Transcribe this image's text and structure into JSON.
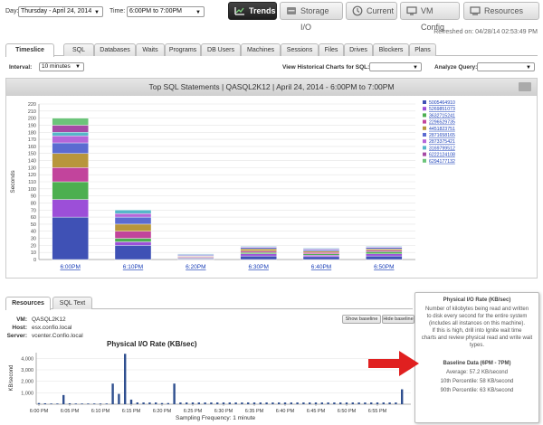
{
  "toolbar": {
    "day_label": "Day:",
    "day_value": "Thursday - April 24, 2014",
    "time_label": "Time:",
    "time_value": "6:00PM to 7:00PM",
    "nav": [
      {
        "label": "Trends",
        "icon": "trends-icon",
        "active": true
      },
      {
        "label": "Storage I/O",
        "icon": "storage-icon",
        "active": false
      },
      {
        "label": "Current",
        "icon": "clock-icon",
        "active": false
      },
      {
        "label": "VM Config",
        "icon": "monitor-icon",
        "active": false
      },
      {
        "label": "Resources",
        "icon": "resources-icon",
        "active": false
      }
    ]
  },
  "refreshed": "Refreshed on: 04/28/14 02:53:49 PM",
  "tabs": [
    "Timeslice",
    "SQL",
    "Databases",
    "Waits",
    "Programs",
    "DB Users",
    "Machines",
    "Sessions",
    "Files",
    "Drives",
    "Blockers",
    "Plans"
  ],
  "options": {
    "interval_label": "Interval:",
    "interval_value": "10 minutes",
    "historical_label": "View Historical Charts for SQL:",
    "analyze_label": "Analyze Query:"
  },
  "top_chart": {
    "title": "Top SQL Statements | QASQL2K12 | April 24, 2014 - 6:00PM to 7:00PM"
  },
  "chart_data": [
    {
      "type": "bar",
      "title": "Top SQL Statements | QASQL2K12 | April 24, 2014 - 6:00PM to 7:00PM",
      "xlabel": "",
      "ylabel": "Seconds",
      "ylim": [
        0,
        220
      ],
      "yticks": [
        0,
        10,
        20,
        30,
        40,
        50,
        60,
        70,
        80,
        90,
        100,
        110,
        120,
        130,
        140,
        150,
        160,
        170,
        180,
        190,
        200,
        210,
        220
      ],
      "grid": true,
      "legend": "right",
      "categories": [
        "6:00PM",
        "6:10PM",
        "6:20PM",
        "6:30PM",
        "6:40PM",
        "6:50PM"
      ],
      "series": [
        {
          "name": "5005464910",
          "color": "#3f51b5",
          "values": [
            60,
            20,
            1,
            5,
            4,
            5
          ]
        },
        {
          "name": "5269851073",
          "color": "#9c4fd8",
          "values": [
            25,
            5,
            1,
            3,
            2,
            3
          ]
        },
        {
          "name": "3632715241",
          "color": "#4caf50",
          "values": [
            25,
            5,
            1,
            2,
            2,
            3
          ]
        },
        {
          "name": "2296529735",
          "color": "#c2449c",
          "values": [
            20,
            10,
            1,
            2,
            2,
            2
          ]
        },
        {
          "name": "4451823751",
          "color": "#b8963c",
          "values": [
            20,
            10,
            1,
            3,
            2,
            2
          ]
        },
        {
          "name": "2871658165",
          "color": "#5b6bd1",
          "values": [
            15,
            10,
            1,
            2,
            2,
            2
          ]
        },
        {
          "name": "2873375421",
          "color": "#b566d9",
          "values": [
            10,
            5,
            1,
            1,
            1,
            1
          ]
        },
        {
          "name": "3169799512",
          "color": "#56b6c9",
          "values": [
            5,
            5,
            1,
            1,
            1,
            1
          ]
        },
        {
          "name": "6222124108",
          "color": "#a64aa5",
          "values": [
            10,
            0,
            0,
            0,
            0,
            0
          ]
        },
        {
          "name": "6294177132",
          "color": "#6cc47a",
          "values": [
            10,
            0,
            0,
            0,
            0,
            0
          ]
        }
      ]
    },
    {
      "type": "bar",
      "title": "Physical I/O Rate (KB/sec)",
      "xlabel": "Sampling Frequency: 1 minute",
      "ylabel": "KB/second",
      "ylim": [
        0,
        4500
      ],
      "yticks": [
        0,
        1000,
        2000,
        3000,
        4000
      ],
      "grid": true,
      "color": "#2f4f8f",
      "tick_labels": [
        "6:00 PM",
        "6:05 PM",
        "6:10 PM",
        "6:15 PM",
        "6:20 PM",
        "6:25 PM",
        "6:30 PM",
        "6:35 PM",
        "6:40 PM",
        "6:45 PM",
        "6:50 PM",
        "6:55 PM"
      ],
      "x_minutes": [
        0,
        1,
        2,
        3,
        4,
        5,
        6,
        7,
        8,
        9,
        10,
        11,
        12,
        13,
        14,
        15,
        16,
        17,
        18,
        19,
        20,
        21,
        22,
        23,
        24,
        25,
        26,
        27,
        28,
        29,
        30,
        31,
        32,
        33,
        34,
        35,
        36,
        37,
        38,
        39,
        40,
        41,
        42,
        43,
        44,
        45,
        46,
        47,
        48,
        49,
        50,
        51,
        52,
        53,
        54,
        55,
        56,
        57,
        58,
        59
      ],
      "values": [
        100,
        80,
        60,
        60,
        800,
        80,
        60,
        60,
        60,
        60,
        60,
        60,
        1800,
        900,
        4400,
        400,
        150,
        150,
        150,
        150,
        100,
        100,
        1800,
        150,
        150,
        150,
        150,
        150,
        150,
        150,
        150,
        150,
        150,
        150,
        150,
        150,
        150,
        150,
        150,
        150,
        150,
        150,
        150,
        150,
        150,
        150,
        150,
        150,
        150,
        150,
        150,
        150,
        150,
        150,
        150,
        150,
        150,
        150,
        150,
        1300
      ]
    }
  ],
  "bottom": {
    "tabs": [
      "Resources",
      "SQL Text"
    ],
    "vm_label": "VM:",
    "vm_value": "QASQL2K12",
    "host_label": "Host:",
    "host_value": "esx.confio.local",
    "server_label": "Server:",
    "server_value": "vcenter.Confio.local",
    "show_baseline": "Show baseline",
    "hide_baseline": "Hide baseline",
    "io_title": "Physical I/O Rate (KB/sec)",
    "io_xlabel": "Sampling Frequency: 1 minute"
  },
  "tooltip": {
    "title": "Physical I/O Rate (KB/sec)",
    "desc1": "Number of kilobytes being read and written",
    "desc2": "to disk every second for the entire system",
    "desc3": "(includes all instances on this machine).",
    "desc4": "If this is high, drill into Ignite wait time",
    "desc5": "charts and review physical read and write wait",
    "desc6": "types.",
    "baseline_title": "Baseline Data (6PM - 7PM)",
    "average": "Average: 57.2 KB/second",
    "p10": "10th Percentile: 58 KB/second",
    "p90": "90th Percentile: 63 KB/second"
  },
  "colors": {
    "accent": "#2b2b2b",
    "arrow": "#e02020",
    "bar_blue": "#2f4f8f"
  }
}
